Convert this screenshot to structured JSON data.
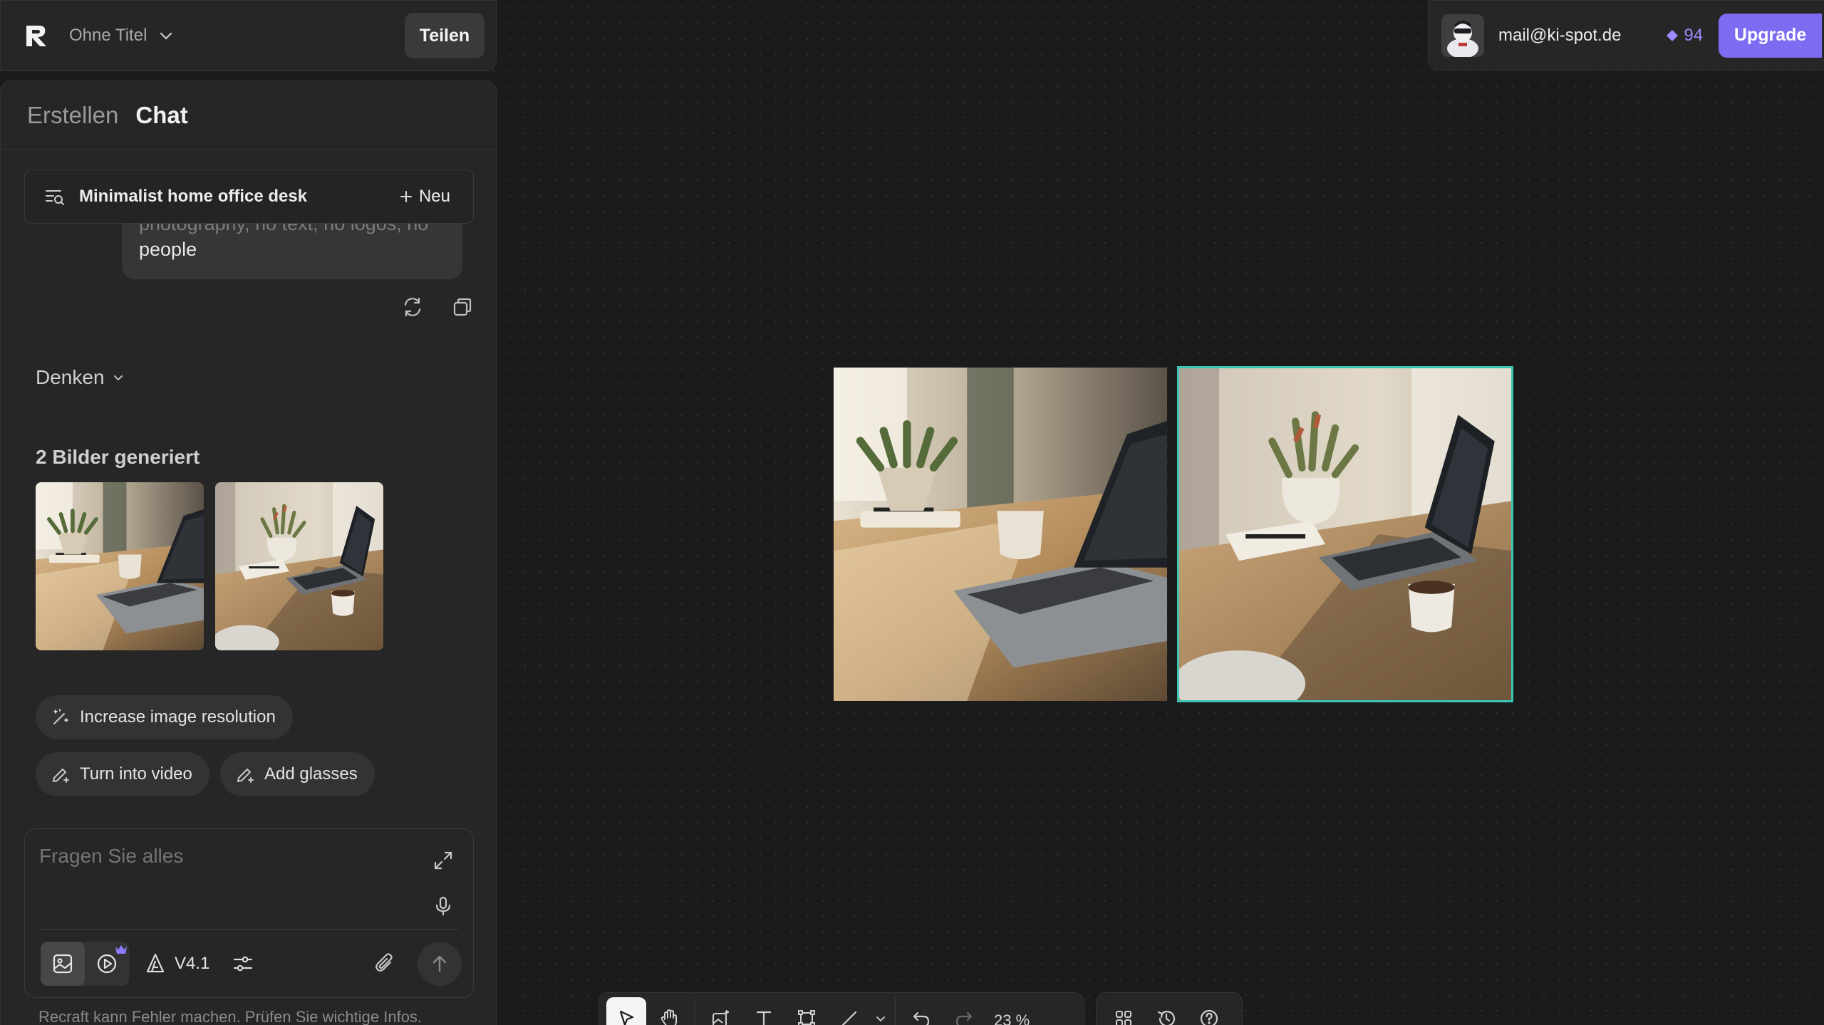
{
  "app": {
    "title": "Ohne Titel",
    "share_label": "Teilen"
  },
  "tabs": {
    "create": "Erstellen",
    "chat": "Chat"
  },
  "conversation": {
    "title": "Minimalist home office desk",
    "new_label": "Neu"
  },
  "prompt_bubble": {
    "line1": "photography, no text, no logos, no",
    "line2": "people"
  },
  "thinking": {
    "label": "Denken"
  },
  "generated": {
    "label": "2 Bilder generiert"
  },
  "suggestions": {
    "increase_resolution": "Increase image resolution",
    "turn_into_video": "Turn into video",
    "add_glasses": "Add glasses"
  },
  "input": {
    "placeholder": "Fragen Sie alles",
    "model": "V4.1"
  },
  "disclaimer": "Recraft kann Fehler machen. Prüfen Sie wichtige Infos.",
  "user": {
    "email": "mail@ki-spot.de",
    "credits": "94",
    "upgrade_label": "Upgrade"
  },
  "toolbar": {
    "zoom": "23 %"
  },
  "colors": {
    "accent": "#7c6cf2",
    "selection": "#3cc7b4",
    "credits": "#9a8bff"
  },
  "icons": [
    "recraft-logo-icon",
    "chevron-down-icon",
    "list-icon",
    "plus-icon",
    "regenerate-icon",
    "copy-icon",
    "magic-wand-icon",
    "pencil-sparkle-icon",
    "expand-icon",
    "microphone-icon",
    "image-icon",
    "video-icon",
    "crown-icon",
    "model-icon",
    "settings-sliders-icon",
    "paperclip-icon",
    "arrow-up-icon",
    "diamond-icon",
    "pointer-icon",
    "hand-icon",
    "image-edit-icon",
    "text-icon",
    "frame-icon",
    "line-icon",
    "undo-icon",
    "redo-icon",
    "grid-icon",
    "history-icon",
    "help-icon"
  ]
}
